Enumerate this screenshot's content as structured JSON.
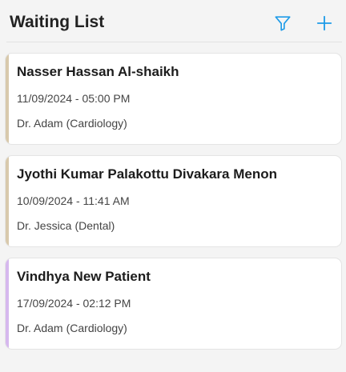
{
  "header": {
    "title": "Waiting List",
    "filter_icon": "filter-icon",
    "add_icon": "plus-icon",
    "icon_color": "#1e9be8"
  },
  "entries": [
    {
      "name": "Nasser Hassan Al-shaikh",
      "datetime": "11/09/2024 - 05:00 PM",
      "doctor": "Dr. Adam",
      "department": "(Cardiology)",
      "accent": "#d8c9ac"
    },
    {
      "name": "Jyothi Kumar Palakottu Divakara Menon",
      "datetime": "10/09/2024 - 11:41 AM",
      "doctor": "Dr. Jessica",
      "department": "(Dental)",
      "accent": "#d8c9ac"
    },
    {
      "name": "Vindhya New Patient",
      "datetime": "17/09/2024 - 02:12 PM",
      "doctor": "Dr. Adam",
      "department": "(Cardiology)",
      "accent": "#d6b8ee"
    }
  ]
}
